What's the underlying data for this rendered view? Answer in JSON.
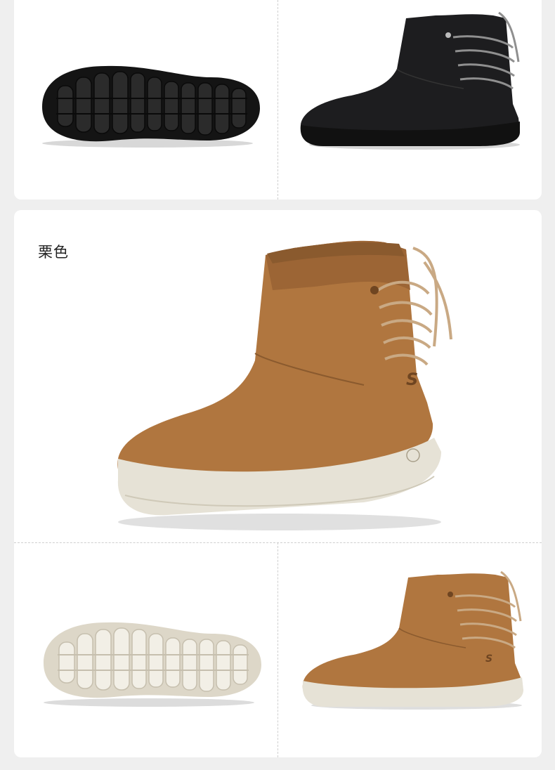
{
  "color_label": "栗色",
  "palette": {
    "chestnut": "#b0763f",
    "chestnut_dark": "#8a5a2e",
    "black_suede": "#1d1d1f",
    "cream_sole": "#e6e2d6"
  },
  "images": [
    {
      "name": "black-boot-sole-image",
      "colorway": "black"
    },
    {
      "name": "black-boot-side-image",
      "colorway": "black"
    },
    {
      "name": "chestnut-boot-hero-image",
      "colorway": "chestnut"
    },
    {
      "name": "chestnut-boot-sole-image",
      "colorway": "chestnut"
    },
    {
      "name": "chestnut-boot-side-image",
      "colorway": "chestnut"
    }
  ]
}
